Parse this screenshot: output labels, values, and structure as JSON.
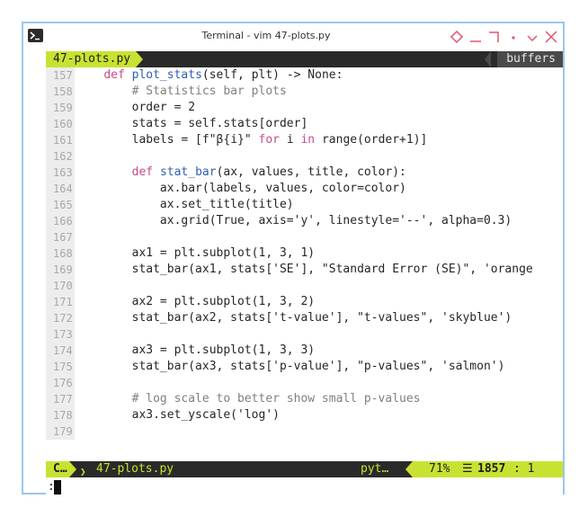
{
  "window": {
    "title": "Terminal - vim 47-plots.py"
  },
  "tabline": {
    "active_tab": "47-plots.py",
    "buffers_label": "buffers"
  },
  "code_lines": [
    {
      "n": "157",
      "segs": [
        [
          "t",
          "    "
        ],
        [
          "kw",
          "def "
        ],
        [
          "fn",
          "plot_stats"
        ],
        [
          "t",
          "(self, plt) -> None:"
        ]
      ]
    },
    {
      "n": "158",
      "segs": [
        [
          "cm",
          "        # Statistics bar plots"
        ]
      ]
    },
    {
      "n": "159",
      "segs": [
        [
          "t",
          "        order = 2"
        ]
      ]
    },
    {
      "n": "160",
      "segs": [
        [
          "t",
          "        stats = self.stats[order]"
        ]
      ]
    },
    {
      "n": "161",
      "segs": [
        [
          "t",
          "        labels = [f\""
        ],
        [
          "st",
          "β{i}"
        ],
        [
          "t",
          "\" "
        ],
        [
          "kw",
          "for"
        ],
        [
          "t",
          " i "
        ],
        [
          "kw",
          "in"
        ],
        [
          "t",
          " range(order+1)]"
        ]
      ]
    },
    {
      "n": "162",
      "segs": []
    },
    {
      "n": "163",
      "segs": [
        [
          "t",
          "        "
        ],
        [
          "kw",
          "def "
        ],
        [
          "fn",
          "stat_bar"
        ],
        [
          "t",
          "(ax, values, title, color):"
        ]
      ]
    },
    {
      "n": "164",
      "segs": [
        [
          "t",
          "            ax.bar(labels, values, color=color)"
        ]
      ]
    },
    {
      "n": "165",
      "segs": [
        [
          "t",
          "            ax.set_title(title)"
        ]
      ]
    },
    {
      "n": "166",
      "segs": [
        [
          "t",
          "            ax.grid(True, axis='y', linestyle='--', alpha=0.3)"
        ]
      ]
    },
    {
      "n": "167",
      "segs": []
    },
    {
      "n": "168",
      "segs": [
        [
          "t",
          "        ax1 = plt.subplot(1, 3, 1)"
        ]
      ]
    },
    {
      "n": "169",
      "segs": [
        [
          "t",
          "        stat_bar(ax1, stats['SE'], \"Standard Error (SE)\", 'orange"
        ]
      ]
    },
    {
      "n": "170",
      "segs": []
    },
    {
      "n": "171",
      "segs": [
        [
          "t",
          "        ax2 = plt.subplot(1, 3, 2)"
        ]
      ]
    },
    {
      "n": "172",
      "segs": [
        [
          "t",
          "        stat_bar(ax2, stats['t-value'], \"t-values\", 'skyblue')"
        ]
      ]
    },
    {
      "n": "173",
      "segs": []
    },
    {
      "n": "174",
      "segs": [
        [
          "t",
          "        ax3 = plt.subplot(1, 3, 3)"
        ]
      ]
    },
    {
      "n": "175",
      "segs": [
        [
          "t",
          "        stat_bar(ax3, stats['p-value'], \"p-values\", 'salmon')"
        ]
      ]
    },
    {
      "n": "176",
      "segs": []
    },
    {
      "n": "177",
      "segs": [
        [
          "cm",
          "        # log scale to better show small p-values"
        ]
      ]
    },
    {
      "n": "178",
      "segs": [
        [
          "t",
          "        ax3.set_yscale('log')"
        ]
      ]
    },
    {
      "n": "179",
      "segs": []
    }
  ],
  "statusline": {
    "mode": "C…",
    "filename": "47-plots.py",
    "filetype": "pyt…",
    "percent": "71%",
    "lines_icon": "☰",
    "line": "1857",
    "col": ": 1"
  },
  "cmdline": {
    "prompt": ":"
  },
  "colors": {
    "accent": "#c9e231",
    "bar_bg": "#2a2a2a",
    "window_border": "#9cc6ea",
    "close": "#e0556b"
  }
}
